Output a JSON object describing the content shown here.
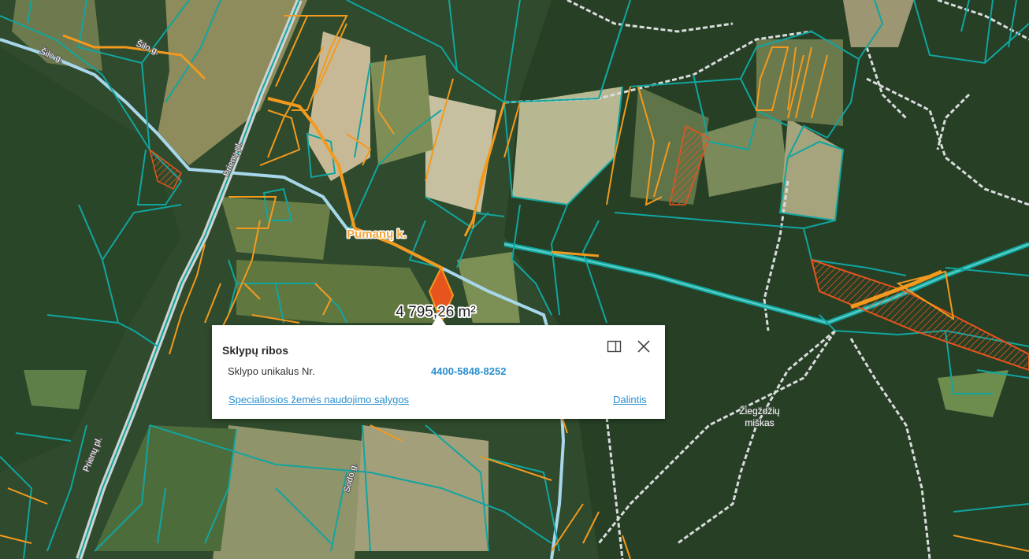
{
  "map": {
    "place_label": "Pumanų k.",
    "forest_label_line1": "Žiegždžių",
    "forest_label_line2": "miškas",
    "road_label_prienu_upper": "Prienų pl.",
    "road_label_prienu_lower": "Prienų pl.",
    "road_label_street_a": "Šilo g.",
    "road_label_street_b": "Šilo g.",
    "road_label_street_c": "Sodo g.",
    "measure_label": "4 795,26 m²",
    "colors": {
      "cadastral_teal": "#11a5a0",
      "selected_orange": "#f39a1e",
      "restriction_red": "#e8541d",
      "road_white": "#d9dcdc",
      "river_blue": "#a8d7ec"
    }
  },
  "popup": {
    "title": "Sklypų ribos",
    "field_label": "Sklypo unikalus Nr.",
    "field_value": "4400-5848-8252",
    "link_conditions": "Specialiosios žemės naudojimo sąlygos",
    "link_share": "Dalintis",
    "dock_icon": "dock-panel-icon",
    "close_icon": "close-icon"
  }
}
